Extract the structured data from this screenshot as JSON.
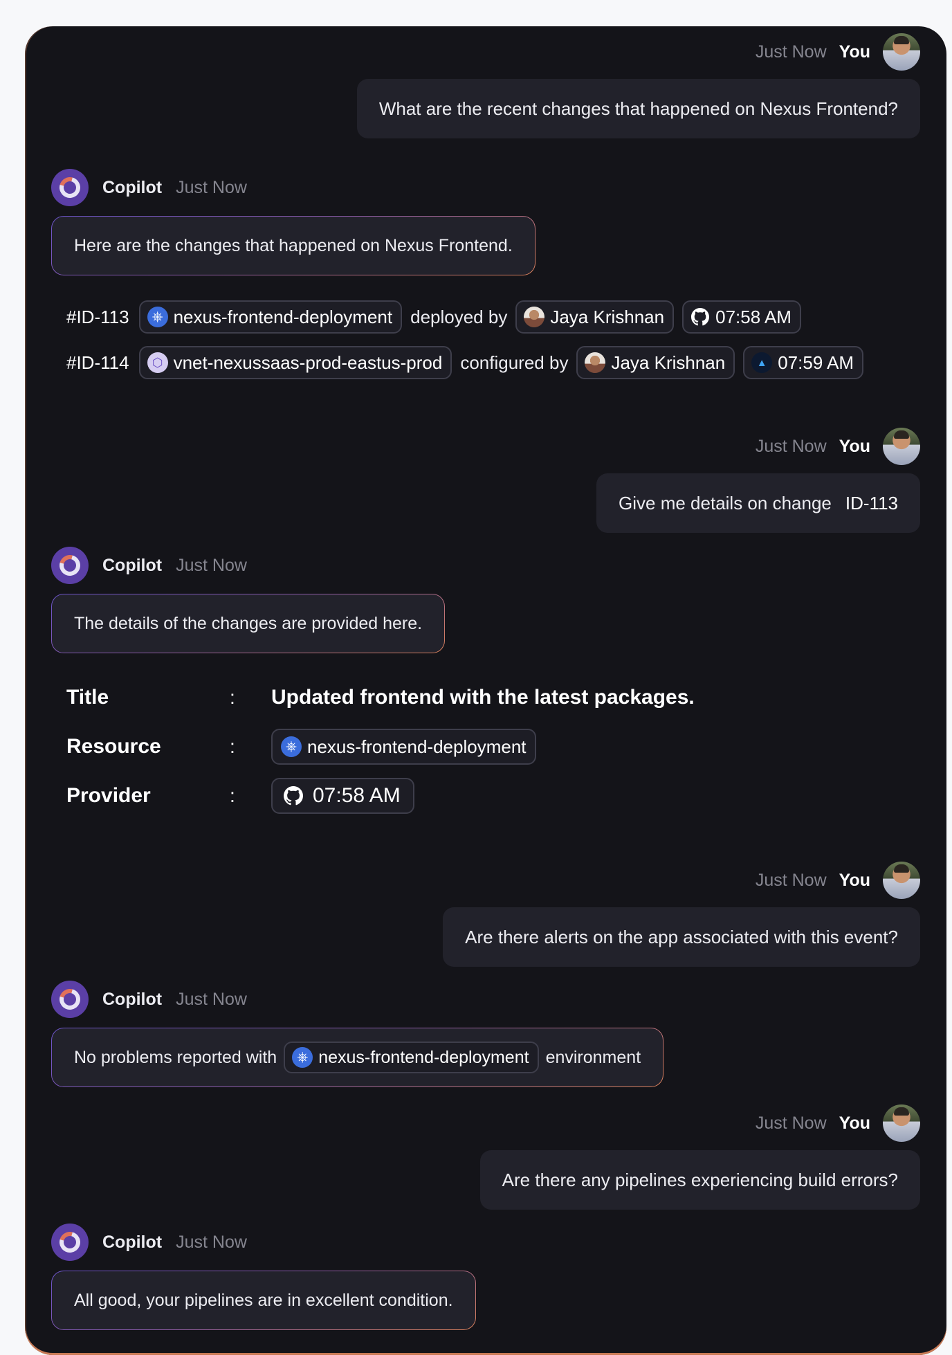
{
  "user": {
    "name": "You",
    "time": "Just Now"
  },
  "copilot": {
    "name": "Copilot",
    "time": "Just Now"
  },
  "messages": {
    "m1": "What are the recent changes that happened on Nexus Frontend?",
    "r1": "Here are the changes that happened on Nexus Frontend.",
    "m2_text": "Give me details on change",
    "m2_id": "ID-113",
    "r2": "The details of the changes are provided here.",
    "m3": "Are there alerts on the app associated with this event?",
    "r3_pre": "No problems reported with",
    "r3_post": "environment",
    "m4": "Are there any pipelines experiencing build errors?",
    "r4": "All good, your pipelines are in excellent condition."
  },
  "changes": [
    {
      "id": "#ID-113",
      "resource": "nexus-frontend-deployment",
      "resource_icon": "kubernetes-icon",
      "action": "deployed by",
      "person": "Jaya Krishnan",
      "provider_icon": "github-icon",
      "time": "07:58 AM"
    },
    {
      "id": "#ID-114",
      "resource": "vnet-nexussaas-prod-eastus-prod",
      "resource_icon": "vnet-icon",
      "action": "configured by",
      "person": "Jaya Krishnan",
      "provider_icon": "azure-icon",
      "time": "07:59 AM"
    }
  ],
  "details": {
    "title_label": "Title",
    "title_value": "Updated frontend with the latest packages.",
    "resource_label": "Resource",
    "resource_value": "nexus-frontend-deployment",
    "provider_label": "Provider",
    "provider_value": "07:58 AM",
    "colon": ":"
  },
  "r3_resource": "nexus-frontend-deployment",
  "colors": {
    "panel": "#141419",
    "bubble": "#22222b",
    "accent_purple": "#5b3fa6",
    "accent_orange": "#d9805a",
    "kubernetes": "#3b6ddc"
  }
}
